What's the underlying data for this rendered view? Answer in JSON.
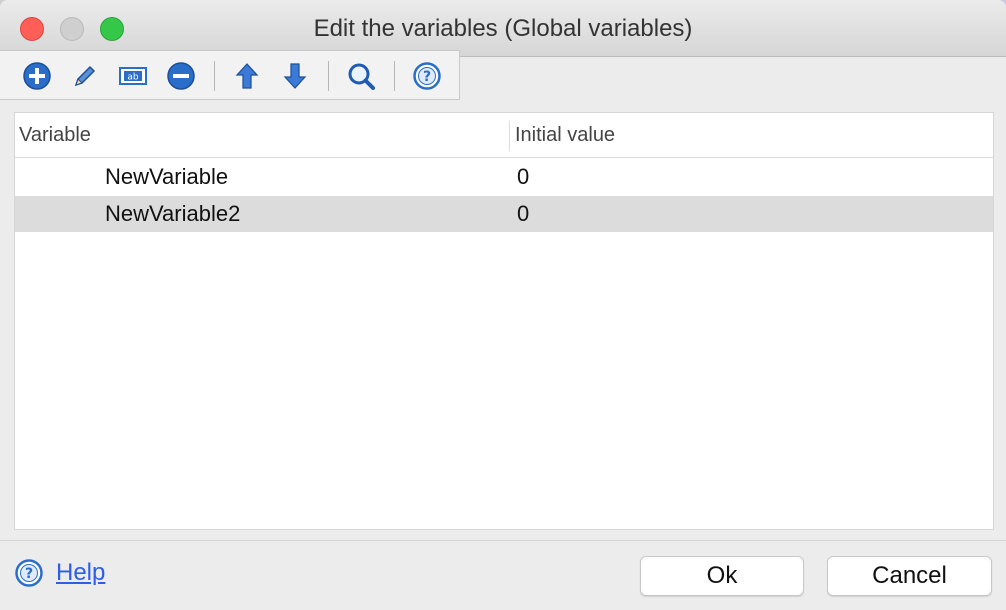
{
  "window": {
    "title": "Edit the variables (Global variables)"
  },
  "toolbar": {
    "buttons": [
      {
        "icon": "add-circle-icon"
      },
      {
        "icon": "pencil-icon"
      },
      {
        "icon": "rename-field-icon",
        "text": "ab"
      },
      {
        "icon": "remove-circle-icon"
      },
      {
        "icon": "arrow-up-icon"
      },
      {
        "icon": "arrow-down-icon"
      },
      {
        "icon": "magnifier-icon"
      },
      {
        "icon": "help-circle-icon",
        "text": "?"
      }
    ]
  },
  "table": {
    "columns": [
      "Variable",
      "Initial value"
    ],
    "rows": [
      {
        "variable": "NewVariable",
        "initial_value": "0"
      },
      {
        "variable": "NewVariable2",
        "initial_value": "0"
      }
    ]
  },
  "footer": {
    "help_label": "Help",
    "help_icon_text": "?",
    "ok_label": "Ok",
    "cancel_label": "Cancel"
  },
  "colors": {
    "accent_blue": "#2c5ee8",
    "icon_blue": "#2a6ec9",
    "close_red": "#fd5f57",
    "maximize_green": "#34c748",
    "selected_row": "#dcdcdc"
  }
}
